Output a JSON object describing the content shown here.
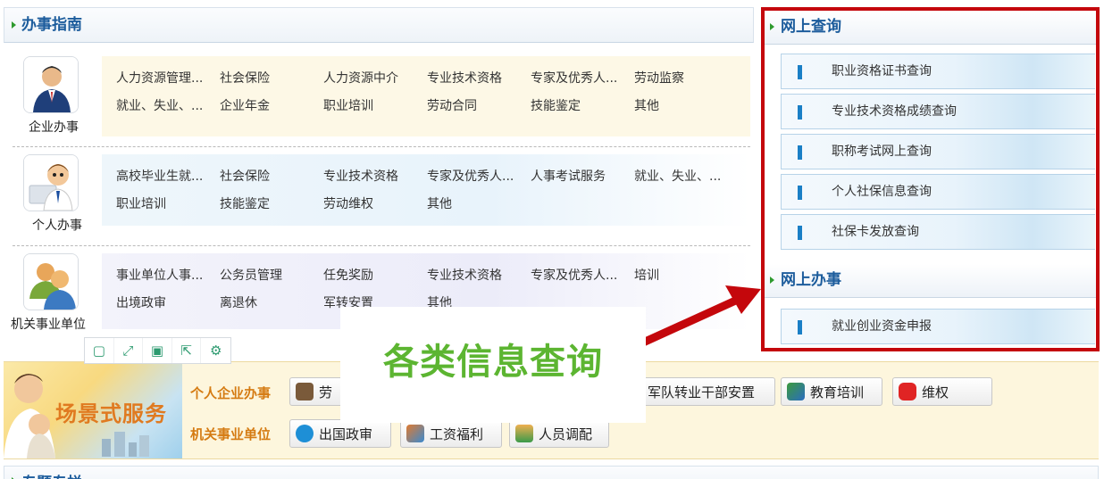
{
  "guide": {
    "title": "办事指南",
    "categories": [
      {
        "label": "企业办事",
        "icon": "business-person-icon",
        "links": [
          [
            "人力资源管理...",
            "社会保险",
            "人力资源中介",
            "专业技术资格",
            "专家及优秀人...",
            "劳动监察"
          ],
          [
            "就业、失业、...",
            "企业年金",
            "职业培训",
            "劳动合同",
            "技能鉴定",
            "其他"
          ]
        ]
      },
      {
        "label": "个人办事",
        "icon": "person-card-icon",
        "links": [
          [
            "高校毕业生就...",
            "社会保险",
            "专业技术资格",
            "专家及优秀人...",
            "人事考试服务",
            "就业、失业、..."
          ],
          [
            "职业培训",
            "技能鉴定",
            "劳动维权",
            "其他"
          ]
        ]
      },
      {
        "label": "机关事业单位",
        "icon": "group-people-icon",
        "links": [
          [
            "事业单位人事...",
            "公务员管理",
            "任免奖励",
            "专业技术资格",
            "专家及优秀人...",
            "培训"
          ],
          [
            "出境政审",
            "离退休",
            "军转安置",
            "其他"
          ]
        ]
      }
    ]
  },
  "online_query": {
    "title": "网上查询",
    "items": [
      "职业资格证书查询",
      "专业技术资格成绩查询",
      "职称考试网上查询",
      "个人社保信息查询",
      "社保卡发放查询"
    ]
  },
  "online_service": {
    "title": "网上办事",
    "items": [
      "就业创业资金申报"
    ]
  },
  "annotation": {
    "text": "各类信息查询",
    "colors": {
      "text": "#5cb531",
      "highlight": "#c4070c"
    }
  },
  "scene": {
    "banner_title": "场景式服务",
    "row1_label": "个人企业办事",
    "row2_label": "机关事业单位",
    "row1_buttons": [
      {
        "label": "劳",
        "icon": "worker-icon"
      },
      {
        "label": "军队转业干部安置",
        "icon": ""
      },
      {
        "label": "教育培训",
        "icon": "training-icon"
      },
      {
        "label": "维权",
        "icon": "hand-stop-icon"
      }
    ],
    "row2_buttons": [
      {
        "label": "出国政审",
        "icon": "airplane-icon"
      },
      {
        "label": "工资福利",
        "icon": "people-salary-icon"
      },
      {
        "label": "人员调配",
        "icon": "person-transfer-icon"
      }
    ]
  },
  "next_section": {
    "title": "专题专栏"
  },
  "toolbar": {
    "icons": [
      "square-icon",
      "expand-icon",
      "save-icon",
      "share-icon",
      "gear-icon"
    ]
  }
}
